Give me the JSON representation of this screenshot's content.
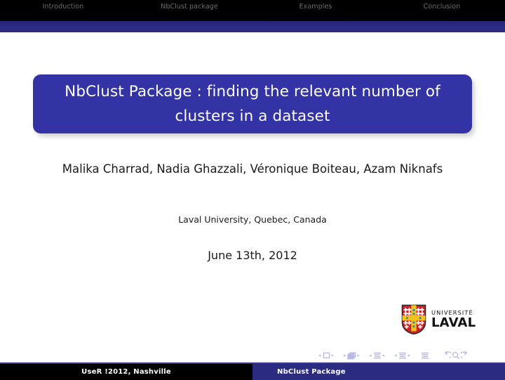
{
  "header": {
    "nav_items": [
      {
        "label": "Introduction"
      },
      {
        "label": "NbClust package"
      },
      {
        "label": "Examples"
      },
      {
        "label": "Conclusion"
      }
    ],
    "bar_color": "#000000",
    "text_color": "#6d6d6d",
    "rule_color": "#2b2b80"
  },
  "title": {
    "text": "NbClust Package : finding the relevant number of clusters in a dataset",
    "box_color": "#3333a6",
    "text_color": "#ffffff"
  },
  "authors": {
    "text": "Malika Charrad, Nadia Ghazzali, Véronique Boiteau, Azam Niknafs"
  },
  "institute": {
    "text": "Laval University, Quebec, Canada"
  },
  "date": {
    "text": "June 13th, 2012"
  },
  "logo": {
    "line1": "UNIVERSITÉ",
    "line2": "LAVAL",
    "shield_field_color": "#cf2027",
    "shield_cross_color": "#f2c31a",
    "shield_border_color": "#2b2b2b"
  },
  "navigation_symbols": {
    "color": "#b9b9e3",
    "groups": [
      {
        "icon": "slide-icon",
        "prev": "◂",
        "next": "▸"
      },
      {
        "icon": "frame-icon",
        "prev": "◂",
        "next": "▸"
      },
      {
        "icon": "subsection-icon",
        "prev": "◂",
        "next": "▸"
      },
      {
        "icon": "section-icon",
        "prev": "◂",
        "next": "▸"
      }
    ],
    "presentation_icon": "presentation-icon",
    "back_icon": "back-icon",
    "search_icon": "search-icon",
    "forward_icon": "forward-icon"
  },
  "footer": {
    "left_text": "UseR !2012, Nashville",
    "right_text": "NbClust Package",
    "left_bg": "#000000",
    "right_bg": "#2b2b80",
    "text_color": "#ffffff"
  }
}
